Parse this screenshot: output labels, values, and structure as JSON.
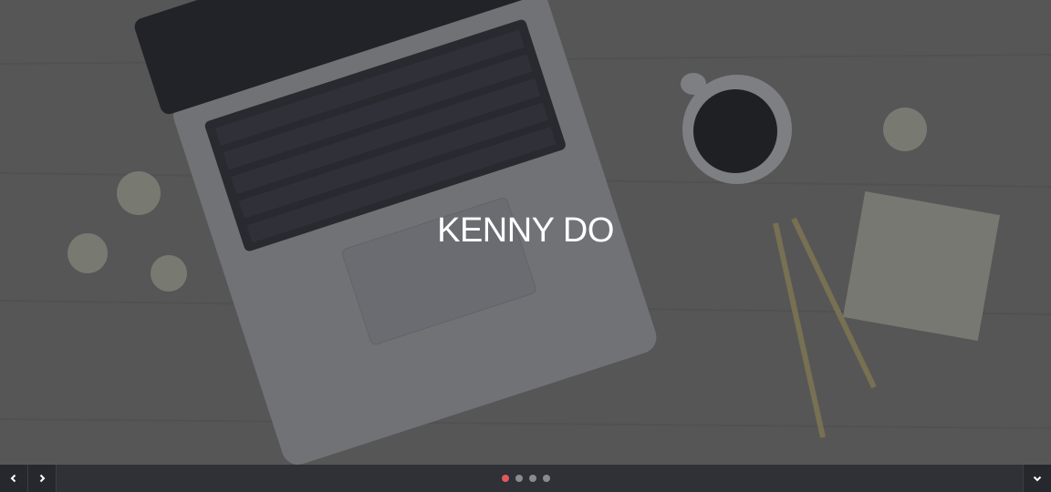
{
  "hero": {
    "title": "KENNY DO"
  },
  "slider": {
    "slide_count": 4,
    "active_index": 0,
    "accent_color": "#e05a5a",
    "inactive_color": "#8a8b90"
  },
  "icons": {
    "prev": "chevron-left-icon",
    "next": "chevron-right-icon",
    "down": "chevron-down-icon"
  }
}
